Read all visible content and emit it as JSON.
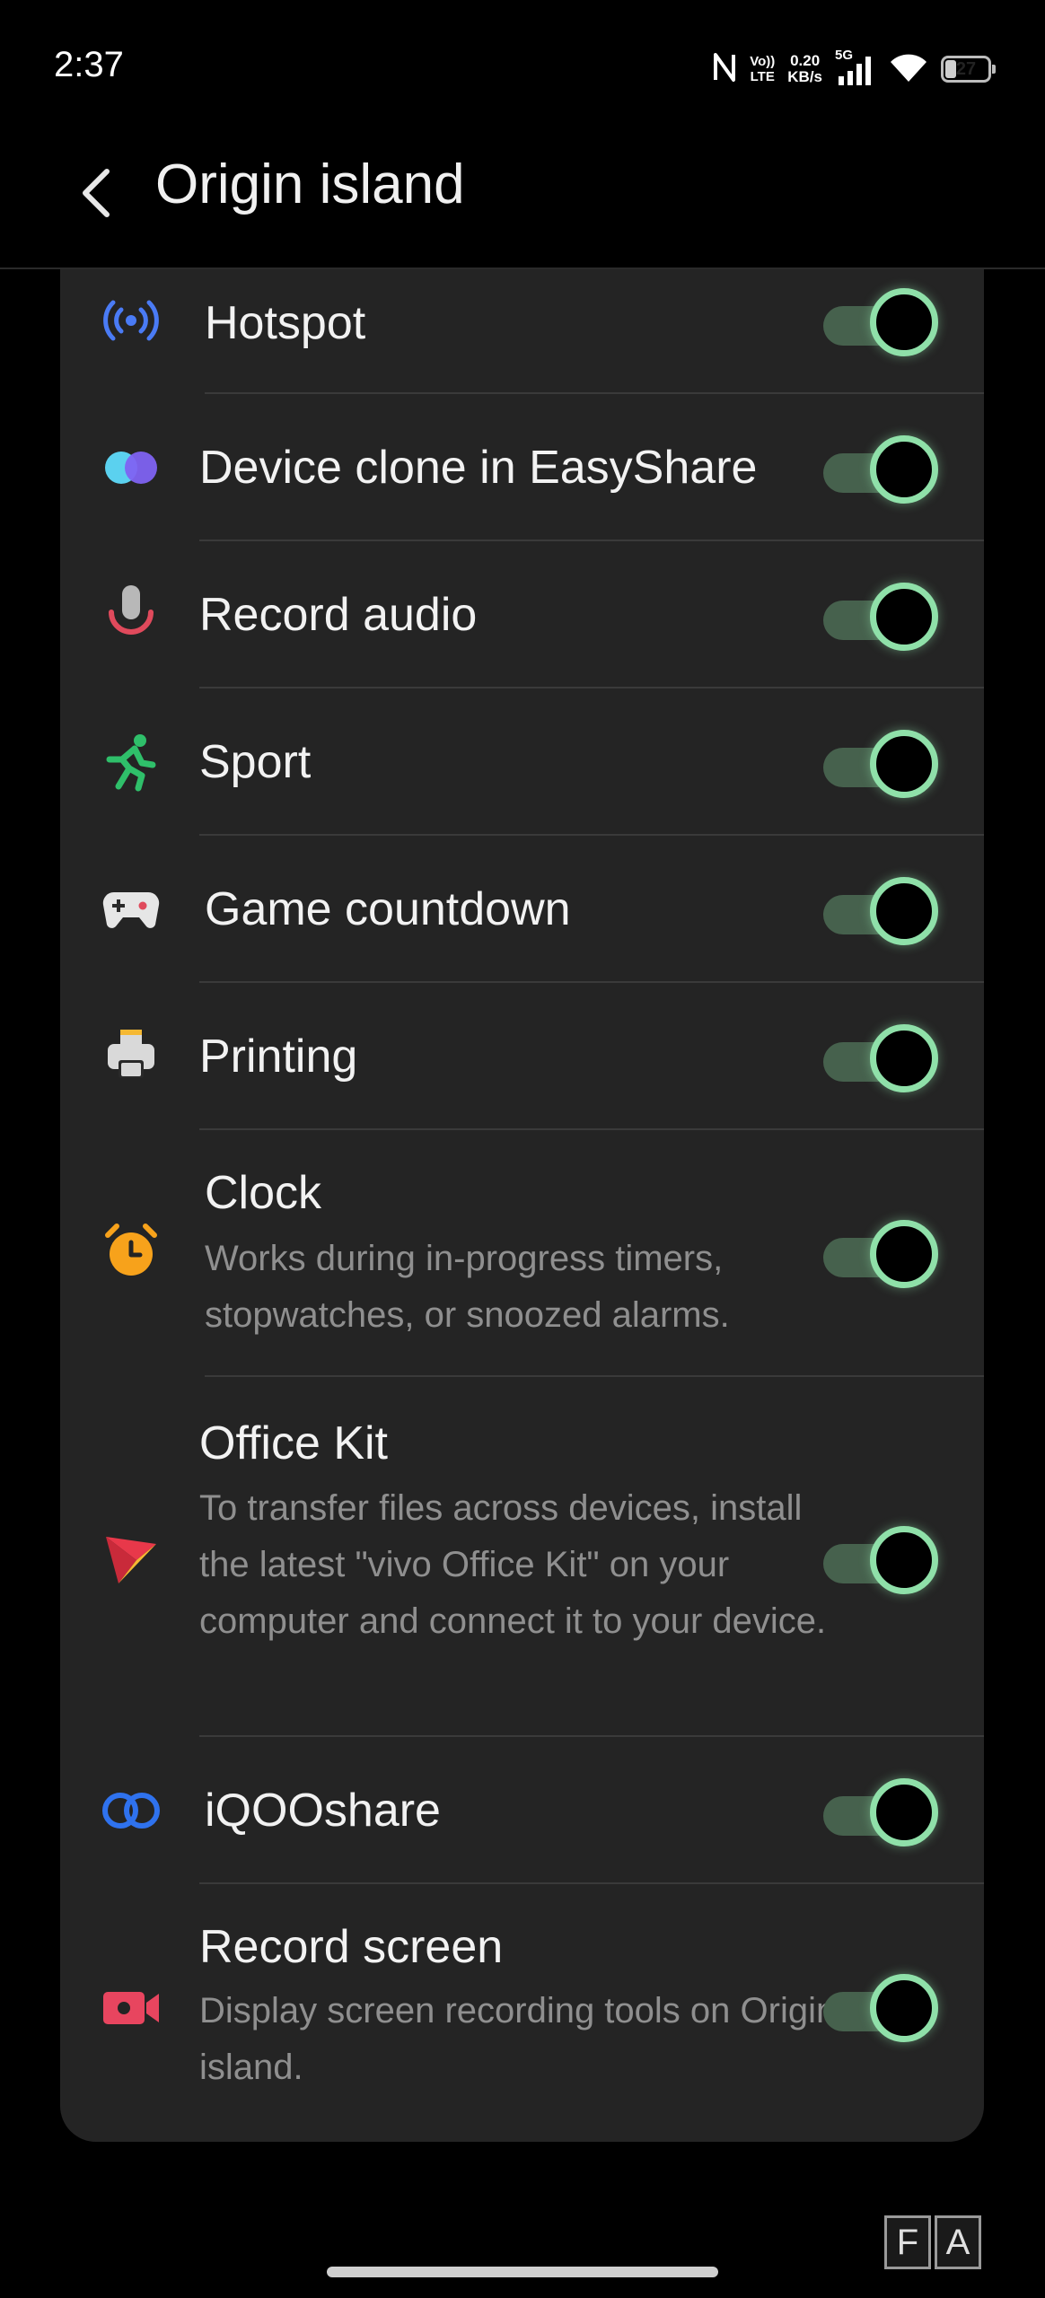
{
  "status_bar": {
    "time": "2:37",
    "volte_top": "Vo))",
    "volte_bottom": "LTE",
    "speed_value": "0.20",
    "speed_unit": "KB/s",
    "network": "5G",
    "battery": "27",
    "battery_level_percent": 27
  },
  "header": {
    "title": "Origin island"
  },
  "items": [
    {
      "title": "Hotspot",
      "desc": "",
      "icon": "hotspot-icon",
      "enabled": true
    },
    {
      "title": "Device clone in EasyShare",
      "desc": "",
      "icon": "easyshare-icon",
      "enabled": true
    },
    {
      "title": "Record audio",
      "desc": "",
      "icon": "microphone-icon",
      "enabled": true
    },
    {
      "title": "Sport",
      "desc": "",
      "icon": "running-person-icon",
      "enabled": true
    },
    {
      "title": "Game countdown",
      "desc": "",
      "icon": "gamepad-icon",
      "enabled": true
    },
    {
      "title": "Printing",
      "desc": "",
      "icon": "printer-icon",
      "enabled": true
    },
    {
      "title": "Clock",
      "desc": "Works during in-progress timers, stopwatches, or snoozed alarms.",
      "icon": "alarm-clock-icon",
      "enabled": true
    },
    {
      "title": "Office Kit",
      "desc": "To transfer files across devices, install the latest \"vivo Office Kit\" on your computer and connect it to your device.",
      "icon": "office-kit-icon",
      "enabled": true
    },
    {
      "title": "iQOOshare",
      "desc": "",
      "icon": "link-rings-icon",
      "enabled": true
    },
    {
      "title": "Record screen",
      "desc": "Display screen recording tools on Origin island.",
      "icon": "video-camera-icon",
      "enabled": true
    }
  ],
  "overlay": {
    "f_label": "F",
    "a_label": "A"
  },
  "colors": {
    "toggle_knob_ring": "#8fe0a9",
    "toggle_track": "#46614d",
    "card_background": "#242424"
  }
}
